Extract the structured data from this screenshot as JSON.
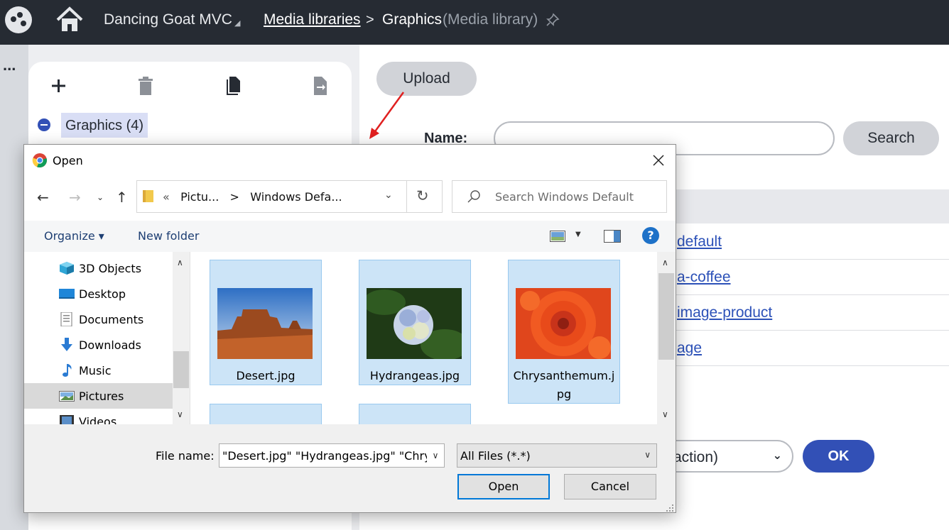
{
  "header": {
    "site_name": "Dancing Goat MVC",
    "breadcrumb_link": "Media libraries",
    "breadcrumb_sep": ">",
    "current_page": "Graphics",
    "current_type": "(Media library)"
  },
  "left_menu": {
    "more_label": "..."
  },
  "tree": {
    "node_label": "Graphics (4)"
  },
  "main": {
    "upload_label": "Upload",
    "name_label": "Name:",
    "search_label": "Search",
    "files": [
      "default",
      "a-coffee",
      "image-product",
      "age"
    ],
    "action_select": "action)",
    "ok_label": "OK"
  },
  "dialog": {
    "title": "Open",
    "address": {
      "part1": "Pictu...",
      "sep1": ">",
      "part2": "Windows Defa...",
      "prefix": "«"
    },
    "search_placeholder": "Search Windows Default",
    "organize_label": "Organize ▾",
    "new_folder_label": "New folder",
    "help_label": "?",
    "nav_items": [
      {
        "label": "3D Objects",
        "icon": "3d-objects-icon"
      },
      {
        "label": "Desktop",
        "icon": "desktop-icon"
      },
      {
        "label": "Documents",
        "icon": "documents-icon"
      },
      {
        "label": "Downloads",
        "icon": "downloads-icon"
      },
      {
        "label": "Music",
        "icon": "music-icon"
      },
      {
        "label": "Pictures",
        "icon": "pictures-icon",
        "selected": true
      },
      {
        "label": "Videos",
        "icon": "videos-icon"
      }
    ],
    "files": [
      {
        "name": "Desert.jpg",
        "icon": "desert-thumbnail"
      },
      {
        "name": "Hydrangeas.jpg",
        "icon": "hydrangeas-thumbnail"
      },
      {
        "name_line1": "Chrysanthemum.j",
        "name_line2": "pg",
        "icon": "chrysanthemum-thumbnail"
      }
    ],
    "file_name_label": "File name:",
    "file_name_value": "\"Desert.jpg\" \"Hydrangeas.jpg\" \"Chry",
    "file_type_value": "All Files (*.*)",
    "open_label": "Open",
    "cancel_label": "Cancel"
  },
  "colors": {
    "topbar": "#262b33",
    "accent": "#3250b6",
    "link": "#2c51b8",
    "selection": "#cce4f7",
    "annotation_arrow": "#e02020"
  }
}
